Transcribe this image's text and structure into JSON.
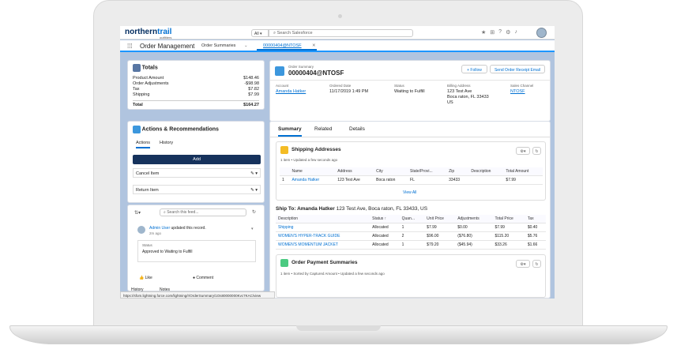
{
  "app": {
    "brand": "northern",
    "brand2": "trail",
    "brand_sub": "outfitters",
    "search_scope": "All",
    "search_placeholder": "Search Salesforce",
    "app_name": "Order Management",
    "nav_tab1": "Order Summaries",
    "nav_tab2": "00000404@NTOSF",
    "url": "https://sfom.lightning.force.com/lightning/r/OrderSummary/1Os80000000Kvc7KAC/view"
  },
  "totals": {
    "title": "Totals",
    "rows": [
      {
        "label": "Product Amount",
        "value": "$148.46"
      },
      {
        "label": "Order Adjustments",
        "value": "-$98.98"
      },
      {
        "label": "Tax",
        "value": "$7.82"
      },
      {
        "label": "Shipping",
        "value": "$7.99"
      }
    ],
    "total_label": "Total",
    "total_value": "$164.27"
  },
  "actions": {
    "title": "Actions & Recommendations",
    "tab1": "Actions",
    "tab2": "History",
    "add": "Add",
    "item1": "Cancel Item",
    "item2": "Return Item"
  },
  "feed": {
    "placeholder": "Search this feed...",
    "user": "Admin User",
    "verb": "updated this record.",
    "time": "2m ago",
    "status_label": "Status",
    "status_value": "Approved to Waiting to Fulfill",
    "like": "Like",
    "comment": "Comment",
    "history": "History",
    "notes": "Notes"
  },
  "header": {
    "kind": "Order Summary",
    "name": "00000404@NTOSF",
    "follow": "+ Follow",
    "send": "Send Order Receipt Email",
    "fields": [
      {
        "label": "Account",
        "value": "Amanda Hatker"
      },
      {
        "label": "Ordered Date",
        "value": "11/17/2019 1:49 PM"
      },
      {
        "label": "Status",
        "value": "Waiting to Fulfill"
      },
      {
        "label": "Billing Address",
        "value": "123 Test Ave"
      },
      {
        "label": "Sales Channel",
        "value": "NTOSF"
      }
    ],
    "billing_line2": "Boca raton, FL 33433",
    "billing_line3": "US"
  },
  "tabs": {
    "summary": "Summary",
    "related": "Related",
    "details": "Details"
  },
  "shipping": {
    "title": "Shipping Addresses",
    "meta": "1 item • Updated a few seconds ago",
    "cols": [
      "Name",
      "Address",
      "City",
      "State/Provi...",
      "Zip",
      "Description",
      "Total Amount"
    ],
    "row": [
      "1",
      "Amanda Hatker",
      "123 Test Ave",
      "Boca raton",
      "FL",
      "33433",
      "",
      "$7.99"
    ],
    "view_all": "View All"
  },
  "shipto": {
    "label": "Ship To: Amanda Hatker",
    "addr": "123 Test Ave, Boca raton, FL  33433, US",
    "cols": [
      "Description",
      "Status ↑",
      "Quan...",
      "Unit Price",
      "Adjustments",
      "Total Price",
      "Tax"
    ],
    "rows": [
      [
        "Shipping",
        "Allocated",
        "1",
        "$7.99",
        "$0.00",
        "$7.99",
        "$0.40"
      ],
      [
        "WOMEN'S HYPER-TRACK GUIDE",
        "Allocated",
        "2",
        "$96.00",
        "($76.80)",
        "$115.20",
        "$5.76"
      ],
      [
        "WOMEN'S MOMENTUM JACKET",
        "Allocated",
        "1",
        "$79.20",
        "($45.94)",
        "$33.26",
        "$1.66"
      ]
    ]
  },
  "payments": {
    "title": "Order Payment Summaries",
    "meta": "1 item • Sorted by Captured Amount • Updated a few seconds ago"
  }
}
